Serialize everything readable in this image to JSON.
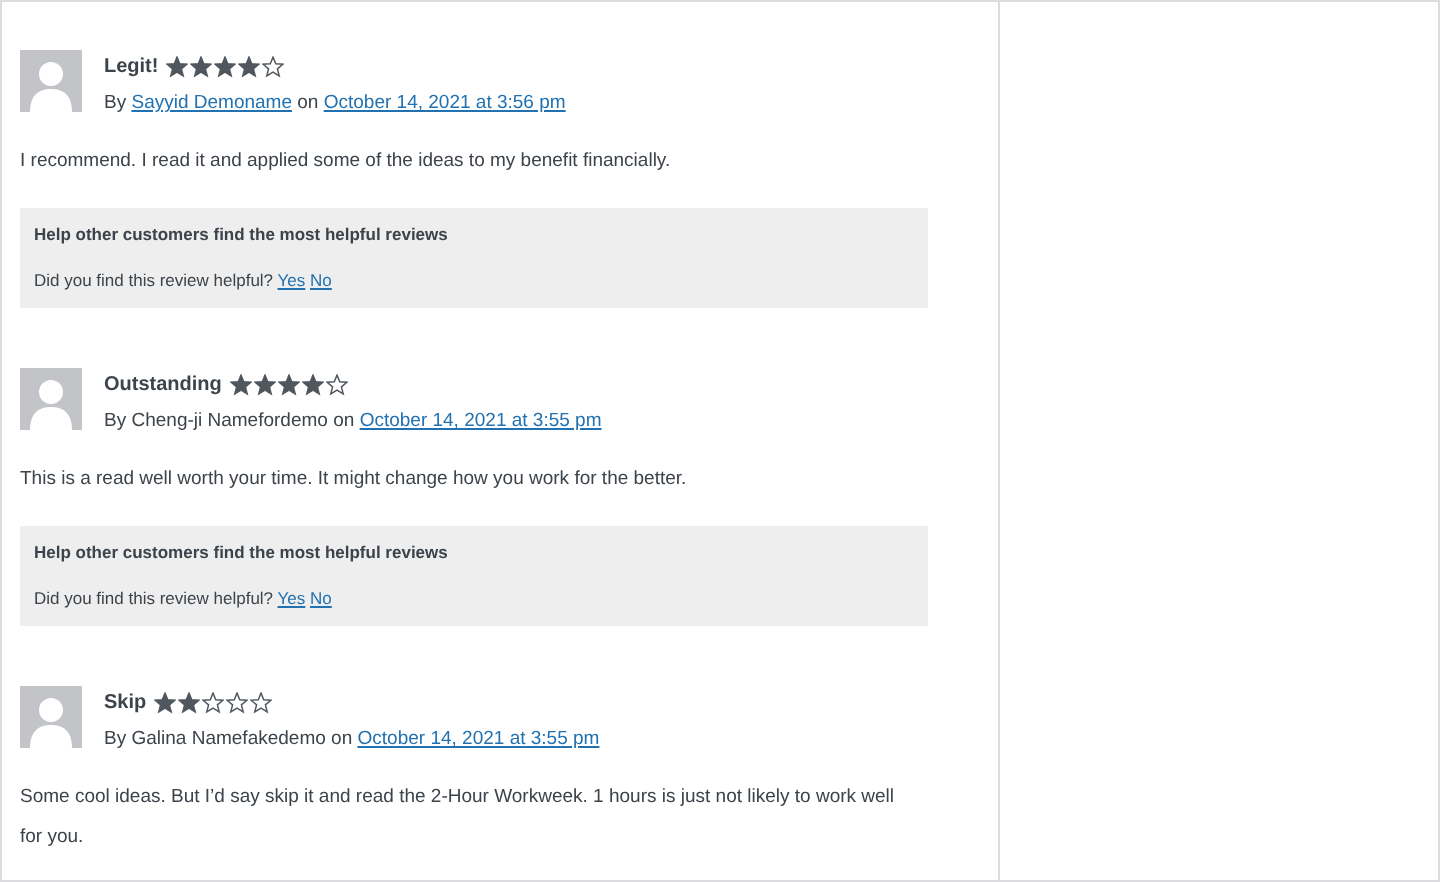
{
  "reviews": [
    {
      "title": "Legit!",
      "stars": 4,
      "by": "By",
      "author": {
        "name": "Sayyid Demoname",
        "link": true
      },
      "on": "on",
      "date": "October 14, 2021 at 3:56 pm",
      "text": "I recommend. I read it and applied some of the ideas to my benefit financially.",
      "helpful": {
        "heading": "Help other customers find the most helpful reviews",
        "question": "Did you find this review helpful?",
        "yes": "Yes",
        "no": "No"
      }
    },
    {
      "title": "Outstanding",
      "stars": 4,
      "by": "By",
      "author": {
        "name": "Cheng-ji Namefordemo",
        "link": false
      },
      "on": "on",
      "date": "October 14, 2021 at 3:55 pm",
      "text": "This is a read well worth your time. It might change how you work for the better.",
      "helpful": {
        "heading": "Help other customers find the most helpful reviews",
        "question": "Did you find this review helpful?",
        "yes": "Yes",
        "no": "No"
      }
    },
    {
      "title": "Skip",
      "stars": 2,
      "by": "By",
      "author": {
        "name": "Galina Namefakedemo",
        "link": false
      },
      "on": "on",
      "date": "October 14, 2021 at 3:55 pm",
      "text": "Some cool ideas. But I’d say skip it and read the 2-Hour Workweek. 1 hours is just not likely to work well for you."
    }
  ]
}
